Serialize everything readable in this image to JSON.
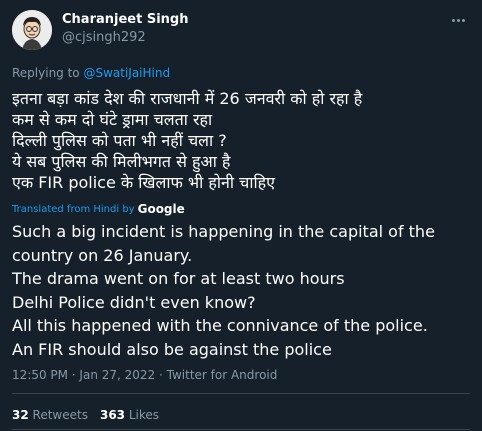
{
  "author": {
    "name": "Charanjeet Singh",
    "handle": "@cjsingh292"
  },
  "reply": {
    "prefix": "Replying to ",
    "mention": "@SwatiJaiHind"
  },
  "hindi_lines": [
    "इतना बड़ा कांड देश की राजधानी में 26 जनवरी को हो रहा है",
    "कम से कम दो घंटे ड्रामा चलता रहा",
    "दिल्ली पुलिस को पता भी नहीं चला ?",
    "ये सब पुलिस की मिलीभगत से हुआ है",
    "एक FIR police के खिलाफ भी होनी चाहिए"
  ],
  "translation": {
    "label": "Translated from Hindi by",
    "provider": "Google"
  },
  "english_lines": [
    "Such a big incident is happening in the capital of the",
    "country on 26 January.",
    " The drama went on for at least two hours",
    " Delhi Police didn't even know?",
    " All this happened with the connivance of the police.",
    " An FIR should also be against the police"
  ],
  "meta": "12:50 PM · Jan 27, 2022 · Twitter for Android",
  "stats": {
    "retweets_count": "32",
    "retweets_label": "Retweets",
    "likes_count": "363",
    "likes_label": "Likes"
  },
  "colors": {
    "background": "#15202b",
    "text": "#ffffff",
    "muted": "#8899a6",
    "link": "#1d9bf0",
    "divider": "#38444d"
  },
  "icons": [
    "avatar-cartoon",
    "more-icon"
  ]
}
